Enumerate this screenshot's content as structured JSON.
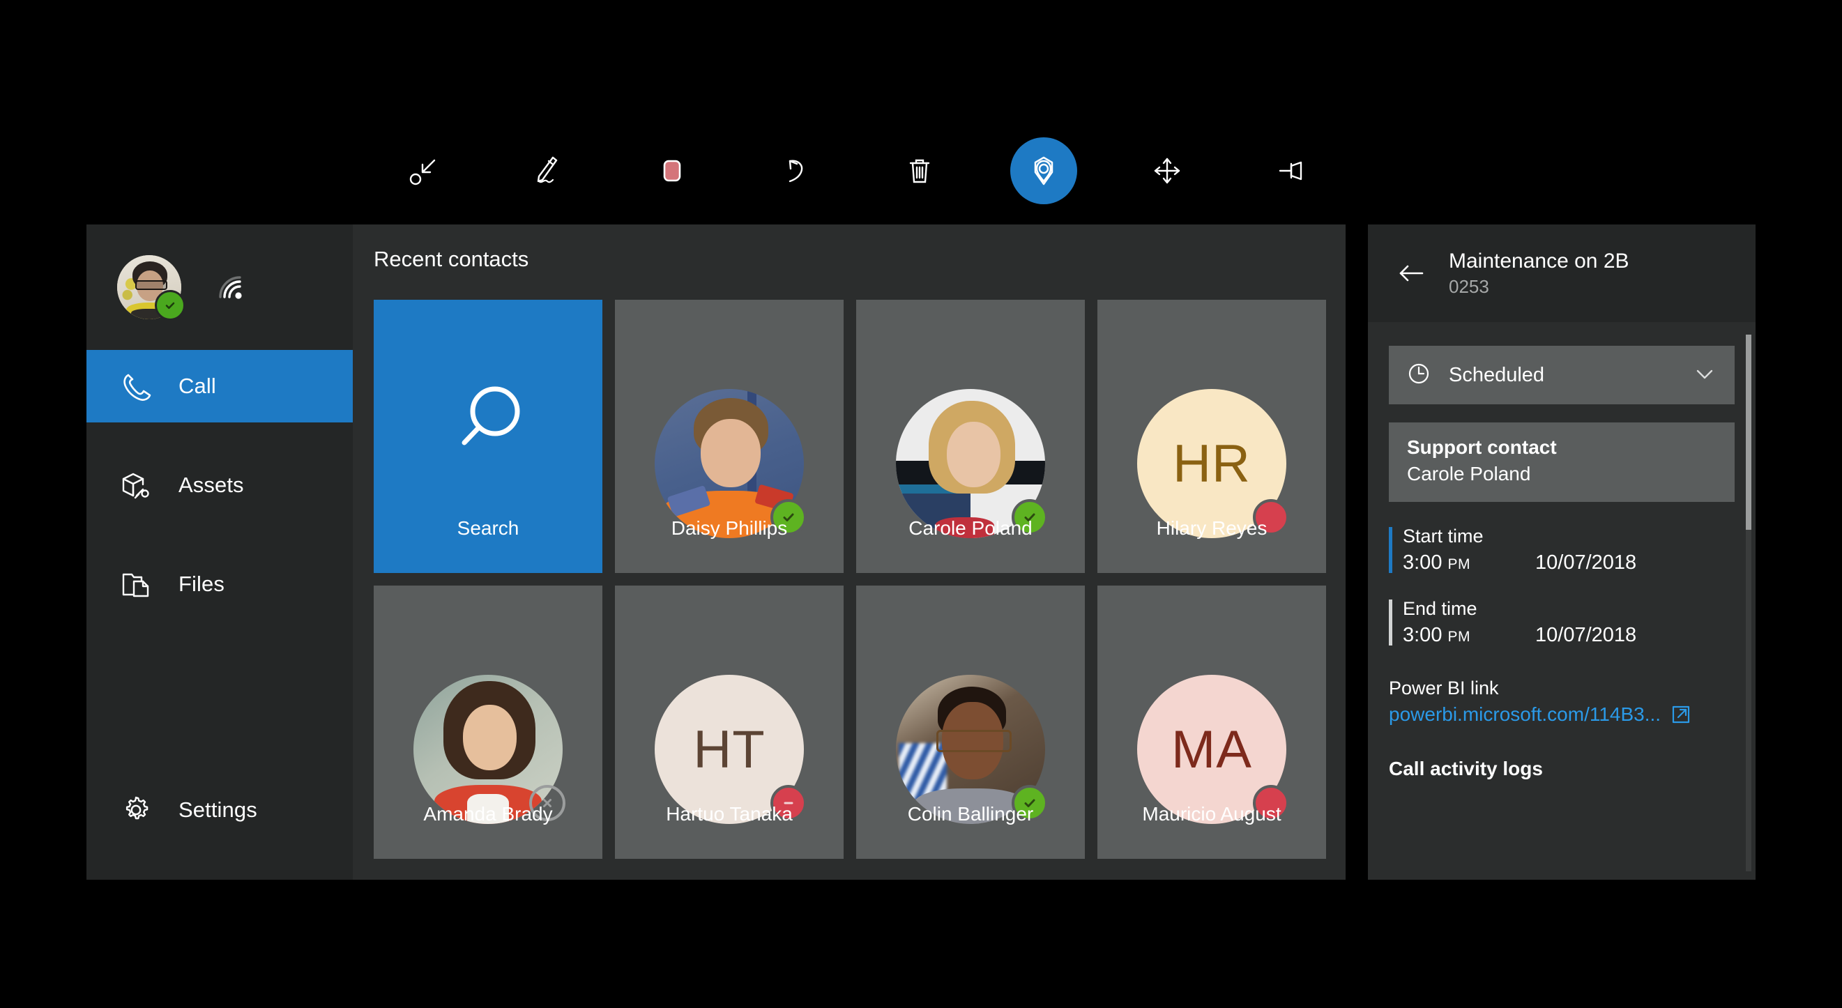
{
  "toolbar": {
    "items": [
      {
        "name": "collapse-icon",
        "label": "Collapse",
        "active": false
      },
      {
        "name": "pen-icon",
        "label": "Ink",
        "active": false
      },
      {
        "name": "color-swatch-icon",
        "label": "Color",
        "active": false,
        "color": "#d4757a"
      },
      {
        "name": "undo-icon",
        "label": "Undo",
        "active": false
      },
      {
        "name": "trash-icon",
        "label": "Delete",
        "active": false
      },
      {
        "name": "anchor-pin-icon",
        "label": "Place anchor",
        "active": true
      },
      {
        "name": "move-icon",
        "label": "Move",
        "active": false
      },
      {
        "name": "pin-icon",
        "label": "Pin",
        "active": false
      }
    ],
    "accent_color": "#1e7ac4",
    "swatch_color": "#d4757a"
  },
  "sidebar": {
    "profile": {
      "avatar_name": "user-avatar",
      "presence": "available",
      "signal_icon": "signal-strength-icon"
    },
    "items": [
      {
        "label": "Call",
        "icon": "phone-icon",
        "selected": true
      },
      {
        "label": "Assets",
        "icon": "assets-box-wrench-icon",
        "selected": false
      },
      {
        "label": "Files",
        "icon": "files-folder-icon",
        "selected": false
      },
      {
        "label": "Settings",
        "icon": "gear-icon",
        "selected": false
      }
    ]
  },
  "main": {
    "title": "Recent contacts",
    "search_tile": {
      "label": "Search",
      "icon": "search-icon"
    },
    "contacts": [
      {
        "name": "Daisy Phillips",
        "type": "photo",
        "portrait": "p-daisy",
        "presence": "available"
      },
      {
        "name": "Carole Poland",
        "type": "photo",
        "portrait": "p-carole",
        "presence": "available"
      },
      {
        "name": "Hilary Reyes",
        "type": "initials",
        "initials": "HR",
        "bg": "#f9e7c4",
        "fg": "#8a6112",
        "presence": "busy"
      },
      {
        "name": "Amanda Brady",
        "type": "photo",
        "portrait": "p-amanda",
        "presence": "offline"
      },
      {
        "name": "Hartuo Tanaka",
        "type": "initials",
        "initials": "HT",
        "bg": "#ece2da",
        "fg": "#5c4434",
        "presence": "dnd"
      },
      {
        "name": "Colin Ballinger",
        "type": "photo",
        "portrait": "p-colin",
        "presence": "available"
      },
      {
        "name": "Mauricio August",
        "type": "initials",
        "initials": "MA",
        "bg": "#f4d6d0",
        "fg": "#7d2a1c",
        "presence": "busy"
      }
    ]
  },
  "detail": {
    "back_icon": "back-arrow-icon",
    "title": "Maintenance on 2B",
    "subtitle": "0253",
    "status": {
      "label": "Scheduled",
      "icon": "clock-icon",
      "chevron": "chevron-down-icon"
    },
    "support": {
      "title": "Support contact",
      "value": "Carole Poland"
    },
    "start_time": {
      "label": "Start time",
      "time": "3:00",
      "ampm": "PM",
      "date": "10/07/2018"
    },
    "end_time": {
      "label": "End time",
      "time": "3:00",
      "ampm": "PM",
      "date": "10/07/2018"
    },
    "powerbi": {
      "label": "Power BI link",
      "url": "powerbi.microsoft.com/114B3...",
      "ext_icon": "external-link-icon"
    },
    "logs_label": "Call activity logs"
  }
}
